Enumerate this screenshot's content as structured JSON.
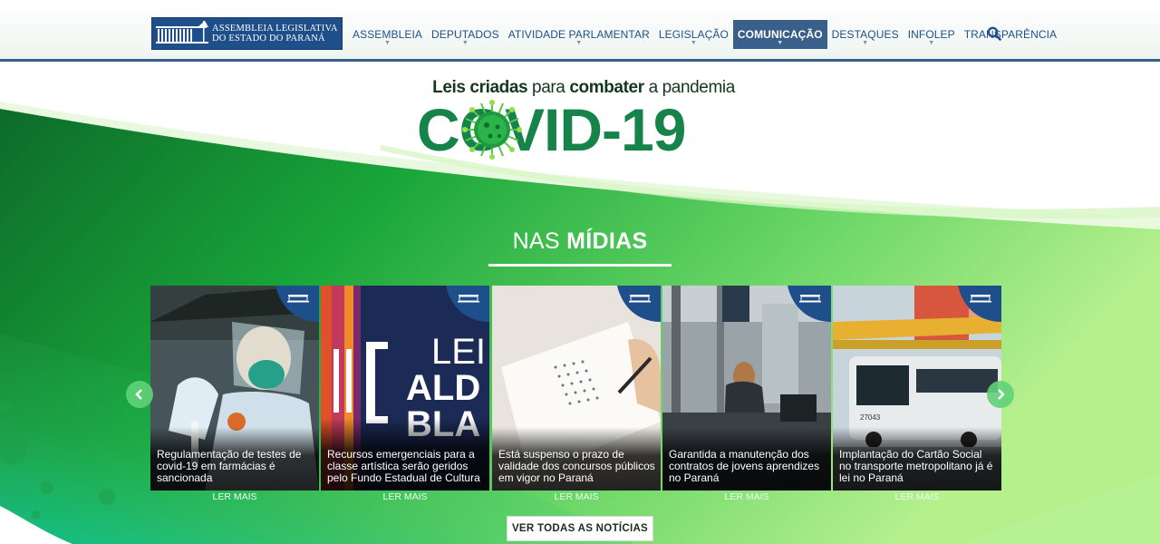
{
  "header": {
    "logo_line1": "ASSEMBLEIA LEGISLATIVA",
    "logo_line2": "DO ESTADO DO PARANÁ",
    "nav": [
      {
        "label": "ASSEMBLEIA",
        "active": false
      },
      {
        "label": "DEPUTADOS",
        "active": false
      },
      {
        "label": "ATIVIDADE PARLAMENTAR",
        "active": false
      },
      {
        "label": "LEGISLAÇÃO",
        "active": false
      },
      {
        "label": "COMUNICAÇÃO",
        "active": true
      },
      {
        "label": "DESTAQUES",
        "active": false
      },
      {
        "label": "INFOLEP",
        "active": false
      },
      {
        "label": "TRANSPARÊNCIA",
        "active": false
      }
    ],
    "search_icon": "search-icon"
  },
  "banner": {
    "subtitle_bold1": "Leis criadas",
    "subtitle_plain1": " para ",
    "subtitle_bold2": "combater",
    "subtitle_plain2": " a pandemia",
    "title": "COVID-19"
  },
  "media": {
    "heading_light": "NAS ",
    "heading_bold": "MÍDIAS",
    "cards": [
      {
        "caption": "Regulamentação de testes de covid-19 em farmácias é sancionada",
        "read_more": "LER MAIS"
      },
      {
        "caption": "Recursos emergenciais para a classe artística serão geridos pelo Fundo Estadual de Cultura",
        "read_more": "LER MAIS",
        "image_text_1": "LEI",
        "image_text_2": "ALD",
        "image_text_3": "BLA"
      },
      {
        "caption": "Está suspenso o prazo de validade dos concursos públicos em vigor no Paraná",
        "read_more": "LER MAIS"
      },
      {
        "caption": "Garantida a manutenção dos contratos de jovens aprendizes no Paraná",
        "read_more": "LER MAIS"
      },
      {
        "caption": "Implantação do Cartão Social no transporte metropolitano já é lei no Paraná",
        "read_more": "LER MAIS",
        "bus_number": "27043"
      }
    ],
    "prev_icon": "chevron-left-icon",
    "next_icon": "chevron-right-icon",
    "all_news": "VER TODAS AS NOTÍCIAS"
  },
  "colors": {
    "brand_blue": "#1f4f8a",
    "nav_active": "#3a5f8a",
    "green_dark": "#0f7a2e",
    "green_light": "#a6ef80"
  }
}
